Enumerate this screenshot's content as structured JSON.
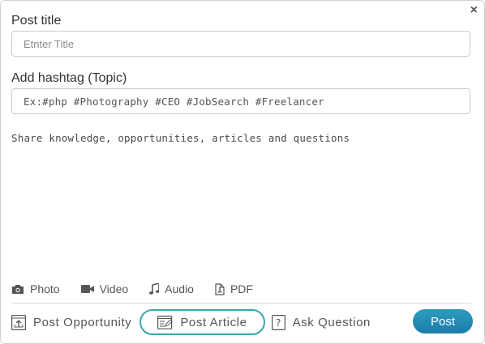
{
  "dialog": {
    "close_icon": "×",
    "title_label": "Post title",
    "title_placeholder": "Etnter Title",
    "hashtag_label": "Add hashtag (Topic)",
    "hashtag_placeholder": "Ex:#php #Photography #CEO #JobSearch #Freelancer",
    "body_placeholder": "Share knowledge, opportunities, articles and questions",
    "media": [
      {
        "label": "Photo",
        "icon": "camera-icon"
      },
      {
        "label": "Video",
        "icon": "video-camera-icon"
      },
      {
        "label": "Audio",
        "icon": "music-note-icon"
      },
      {
        "label": "PDF",
        "icon": "pdf-file-icon"
      }
    ],
    "post_types": [
      {
        "label": "Post Opportunity",
        "icon": "upload-box-icon",
        "active": false
      },
      {
        "label": "Post Article",
        "icon": "article-edit-icon",
        "active": true
      },
      {
        "label": "Ask Question",
        "icon": "question-box-icon",
        "active": false
      }
    ],
    "post_button": "Post",
    "colors": {
      "accent": "#1f88b3",
      "active_border": "#3aa6ad"
    }
  }
}
